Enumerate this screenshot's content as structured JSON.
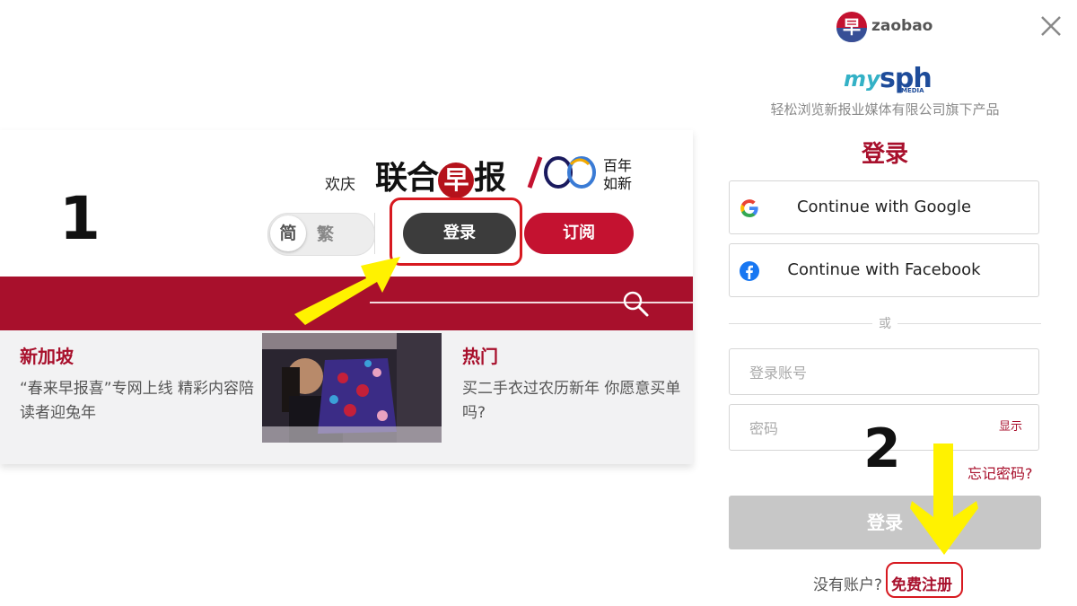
{
  "instruction_steps": [
    "1",
    "2"
  ],
  "site_header": {
    "celebrate_text": "欢庆",
    "masthead_part1": "联合",
    "masthead_zao": "早",
    "masthead_part2": "报",
    "masthead_100": "/OO",
    "century_line1": "百年",
    "century_line2": "如新",
    "lang_simplified": "简",
    "lang_traditional": "繁",
    "login_label": "登录",
    "subscribe_label": "订阅"
  },
  "stories": [
    {
      "category": "新加坡",
      "title": "“春来早报喜”专网上线 精彩内容陪读者迎兔年"
    },
    {
      "category": "热门",
      "title": "买二手衣过农历新年 你愿意买单吗?"
    }
  ],
  "login_dialog": {
    "brand_badge": "早",
    "brand_word": "zaobao",
    "account_logo_my": "my",
    "account_logo_sph": "sph",
    "account_logo_media": "MEDIA",
    "tagline": "轻松浏览新报业媒体有限公司旗下产品",
    "title": "登录",
    "google_label": "Continue with Google",
    "facebook_label": "Continue with Facebook",
    "or_text": "或",
    "account_placeholder": "登录账号",
    "password_placeholder": "密码",
    "show_label": "显示",
    "forgot_label": "忘记密码?",
    "submit_label": "登录",
    "no_account_text": "没有账户?",
    "register_label": "免费注册"
  },
  "colors": {
    "brand_red": "#a8102c",
    "highlight_red": "#d71920",
    "arrow_yellow": "#fff200",
    "login_dark": "#3c3c3c"
  },
  "icons": [
    "search-icon",
    "close-icon",
    "google-icon",
    "facebook-icon"
  ]
}
